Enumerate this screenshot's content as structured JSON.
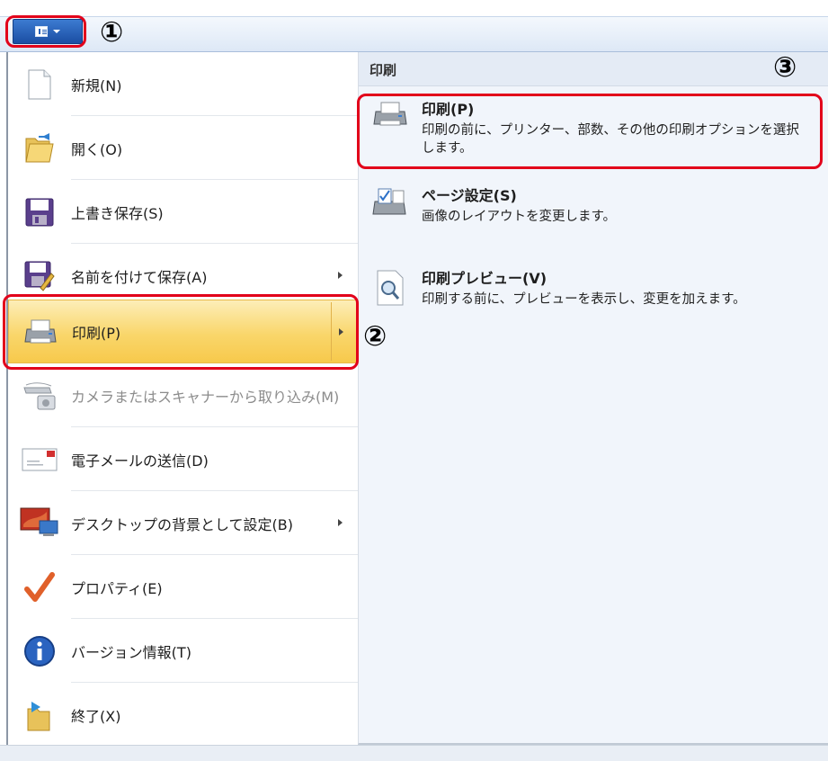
{
  "annotations": {
    "one": "①",
    "two": "②",
    "three": "③"
  },
  "menu": {
    "items": [
      {
        "label": "新規(N)",
        "icon": "new-document-icon"
      },
      {
        "label": "開く(O)",
        "icon": "open-folder-icon"
      },
      {
        "label": "上書き保存(S)",
        "icon": "save-disk-icon"
      },
      {
        "label": "名前を付けて保存(A)",
        "icon": "save-as-icon"
      },
      {
        "label": "印刷(P)",
        "icon": "printer-icon"
      },
      {
        "label": "カメラまたはスキャナーから取り込み(M)",
        "icon": "scanner-camera-icon"
      },
      {
        "label": "電子メールの送信(D)",
        "icon": "email-envelope-icon"
      },
      {
        "label": "デスクトップの背景として設定(B)",
        "icon": "desktop-monitor-icon"
      },
      {
        "label": "プロパティ(E)",
        "icon": "checkmark-icon"
      },
      {
        "label": "バージョン情報(T)",
        "icon": "info-icon"
      },
      {
        "label": "終了(X)",
        "icon": "exit-icon"
      }
    ]
  },
  "print_pane": {
    "header": "印刷",
    "items": [
      {
        "title": "印刷(P)",
        "desc": "印刷の前に、プリンター、部数、その他の印刷オプションを選択します。",
        "icon": "printer-icon"
      },
      {
        "title": "ページ設定(S)",
        "desc": "画像のレイアウトを変更します。",
        "icon": "page-setup-icon"
      },
      {
        "title": "印刷プレビュー(V)",
        "desc": "印刷する前に、プレビューを表示し、変更を加えます。",
        "icon": "print-preview-icon"
      }
    ]
  },
  "colors": {
    "annotation_red": "#e2001a",
    "hot_item_gold": "#f9d66b",
    "app_button_blue": "#1b4ea3"
  }
}
